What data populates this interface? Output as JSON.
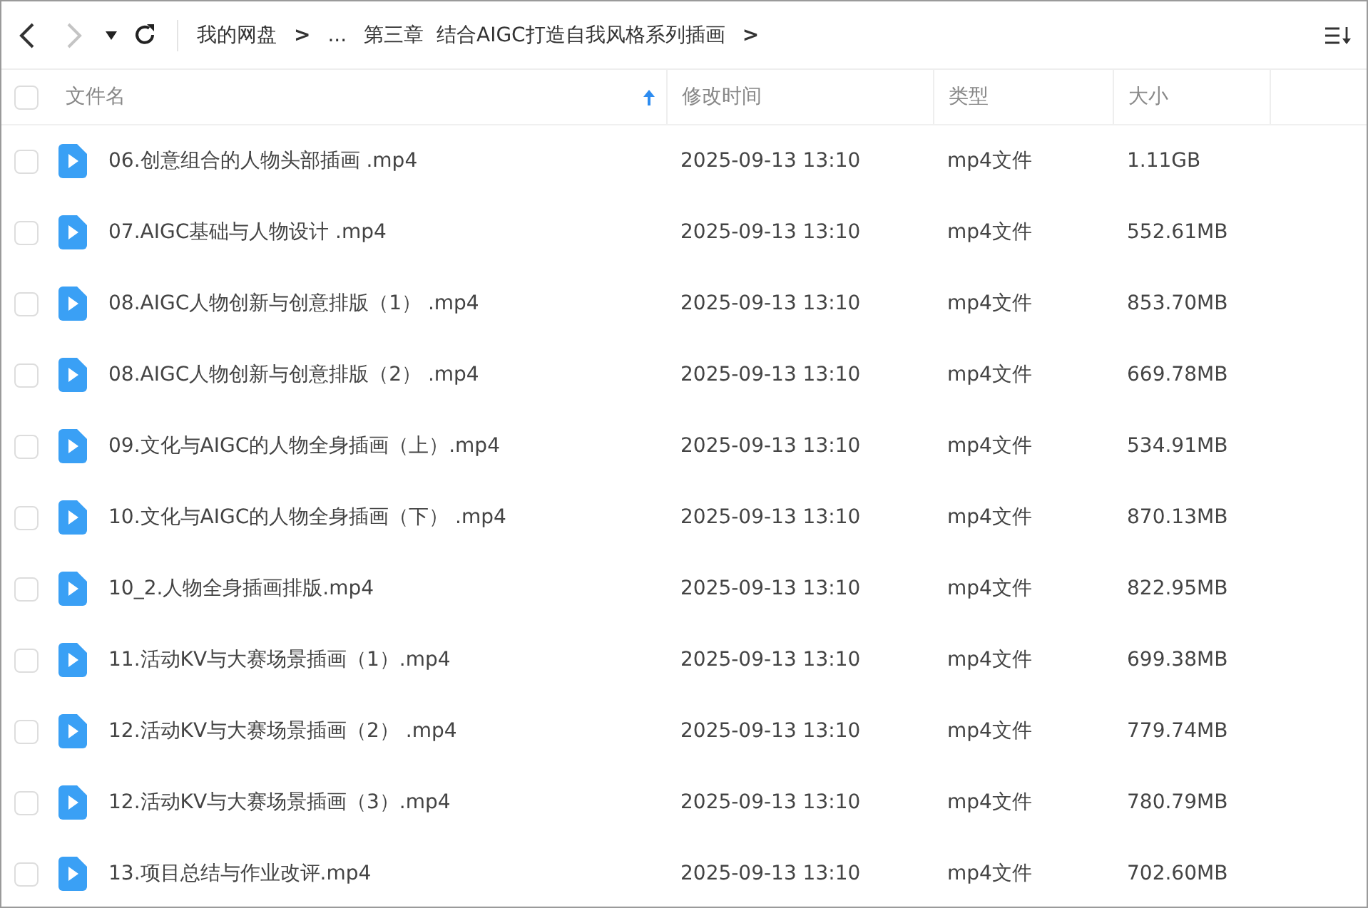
{
  "navigation": {
    "back": {
      "disabled": false
    },
    "forward": {
      "disabled": true
    }
  },
  "breadcrumb": [
    {
      "kind": "folder",
      "label": "我的网盘"
    },
    {
      "kind": "separator",
      "label": ">"
    },
    {
      "kind": "folder",
      "label": "..."
    },
    {
      "kind": "folder",
      "label": "第三章  结合AIGC打造自我风格系列插画"
    },
    {
      "kind": "separator",
      "label": ">"
    }
  ],
  "table": {
    "select_all": {
      "checked": false
    },
    "columns": [
      {
        "label": "文件名",
        "sorted": true
      },
      {
        "label": "修改时间",
        "sorted": false
      },
      {
        "label": "类型",
        "sorted": false
      },
      {
        "label": "大小",
        "sorted": false
      }
    ],
    "rows": [
      {
        "checked": false,
        "name": "06.创意组合的人物头部插画 .mp4",
        "modified": "2025-09-13 13:10",
        "type": "mp4文件",
        "size": "1.11GB"
      },
      {
        "checked": false,
        "name": "07.AIGC基础与人物设计 .mp4",
        "modified": "2025-09-13 13:10",
        "type": "mp4文件",
        "size": "552.61MB"
      },
      {
        "checked": false,
        "name": "08.AIGC人物创新与创意排版（1） .mp4",
        "modified": "2025-09-13 13:10",
        "type": "mp4文件",
        "size": "853.70MB"
      },
      {
        "checked": false,
        "name": "08.AIGC人物创新与创意排版（2） .mp4",
        "modified": "2025-09-13 13:10",
        "type": "mp4文件",
        "size": "669.78MB"
      },
      {
        "checked": false,
        "name": "09.文化与AIGC的人物全身插画（上）.mp4",
        "modified": "2025-09-13 13:10",
        "type": "mp4文件",
        "size": "534.91MB"
      },
      {
        "checked": false,
        "name": "10.文化与AIGC的人物全身插画（下） .mp4",
        "modified": "2025-09-13 13:10",
        "type": "mp4文件",
        "size": "870.13MB"
      },
      {
        "checked": false,
        "name": "10_2.人物全身插画排版.mp4",
        "modified": "2025-09-13 13:10",
        "type": "mp4文件",
        "size": "822.95MB"
      },
      {
        "checked": false,
        "name": "11.活动KV与大赛场景插画（1）.mp4",
        "modified": "2025-09-13 13:10",
        "type": "mp4文件",
        "size": "699.38MB"
      },
      {
        "checked": false,
        "name": "12.活动KV与大赛场景插画（2） .mp4",
        "modified": "2025-09-13 13:10",
        "type": "mp4文件",
        "size": "779.74MB"
      },
      {
        "checked": false,
        "name": "12.活动KV与大赛场景插画（3）.mp4",
        "modified": "2025-09-13 13:10",
        "type": "mp4文件",
        "size": "780.79MB"
      },
      {
        "checked": false,
        "name": "13.项目总结与作业改评.mp4",
        "modified": "2025-09-13 13:10",
        "type": "mp4文件",
        "size": "702.60MB"
      }
    ]
  }
}
